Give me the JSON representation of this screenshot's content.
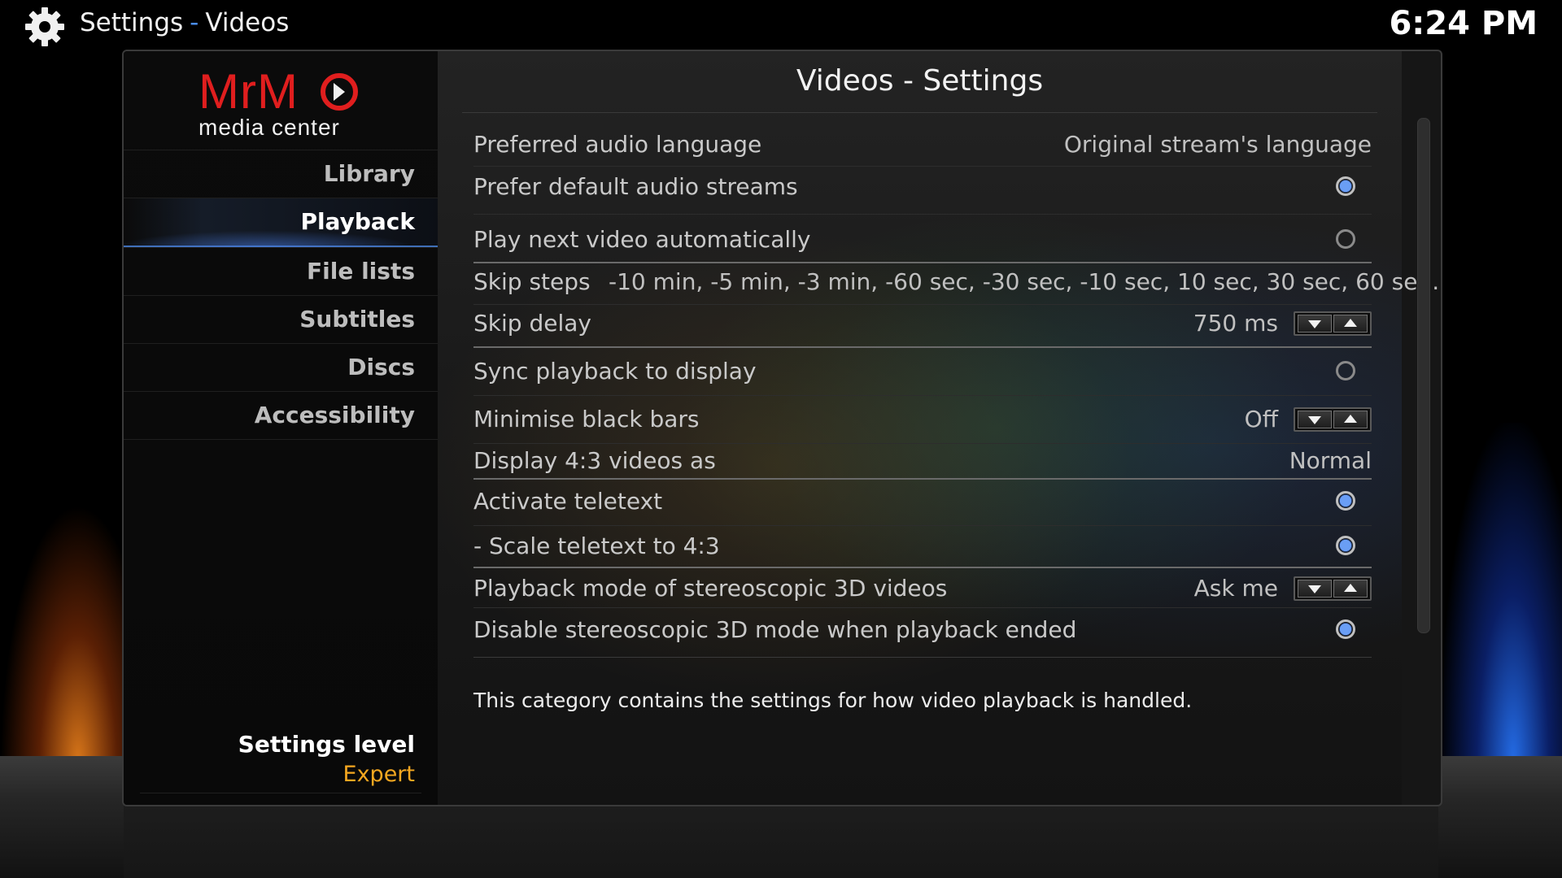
{
  "topbar": {
    "icon": "gear-icon",
    "section": "Settings",
    "separator": "-",
    "page": "Videos",
    "clock": "6:24 PM"
  },
  "logo": {
    "brand": "MrMC",
    "tagline": "media center",
    "brand_color": "#e01e1e"
  },
  "sidebar": {
    "items": [
      {
        "label": "Library",
        "active": false
      },
      {
        "label": "Playback",
        "active": true
      },
      {
        "label": "File lists",
        "active": false
      },
      {
        "label": "Subtitles",
        "active": false
      },
      {
        "label": "Discs",
        "active": false
      },
      {
        "label": "Accessibility",
        "active": false
      }
    ],
    "settings_level_label": "Settings level",
    "settings_level_value": "Expert"
  },
  "main": {
    "title": "Videos - Settings",
    "settings": [
      {
        "label": "Preferred audio language",
        "type": "value",
        "value": "Original stream's language"
      },
      {
        "label": "Prefer default audio streams",
        "type": "radio",
        "checked": true
      },
      {
        "label": "Play next video automatically",
        "type": "radio",
        "checked": false
      },
      {
        "label": "Skip steps",
        "type": "list",
        "value": "-10 min, -5 min, -3 min, -60 sec, -30 sec, -10 sec, 10 sec, 30 sec, 60 se..."
      },
      {
        "label": "Skip delay",
        "type": "spinner",
        "value": "750 ms"
      },
      {
        "label": "Sync playback to display",
        "type": "radio",
        "checked": false
      },
      {
        "label": "Minimise black bars",
        "type": "spinner",
        "value": "Off"
      },
      {
        "label": "Display 4:3 videos as",
        "type": "value",
        "value": "Normal"
      },
      {
        "label": "Activate teletext",
        "type": "radio",
        "checked": true
      },
      {
        "label": "- Scale teletext to 4:3",
        "type": "radio",
        "checked": true
      },
      {
        "label": "Playback mode of stereoscopic 3D videos",
        "type": "spinner",
        "value": "Ask me"
      },
      {
        "label": "Disable stereoscopic 3D mode when playback ended",
        "type": "radio",
        "checked": true
      }
    ],
    "description": "This category contains the settings for how video playback is handled."
  },
  "colors": {
    "accent": "#5a8ef0",
    "level_value": "#f4a720"
  }
}
